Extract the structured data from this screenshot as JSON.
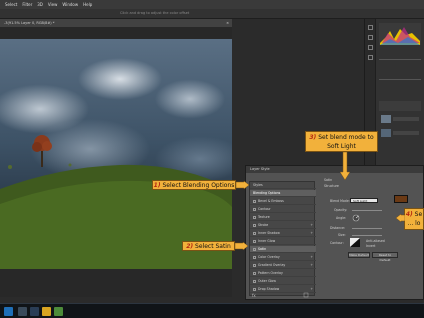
{
  "menubar": {
    "items": [
      "Select",
      "Filter",
      "3D",
      "View",
      "Window",
      "Help"
    ]
  },
  "options_hint": "Click and drag to adjust the color offset",
  "document": {
    "tab_title": "-3(91.5% Layer 0, RGB/8#) *",
    "close": "×"
  },
  "dialog": {
    "title": "Layer Style",
    "list_rows": [
      {
        "label": "Styles",
        "checkbox": false,
        "selected": false,
        "plus": false
      },
      {
        "label": "Blending Options",
        "checkbox": false,
        "selected": true,
        "plus": false
      },
      {
        "label": "Bevel & Emboss",
        "checkbox": true,
        "selected": false,
        "plus": false
      },
      {
        "label": "Contour",
        "checkbox": true,
        "selected": false,
        "plus": false
      },
      {
        "label": "Texture",
        "checkbox": true,
        "selected": false,
        "plus": false
      },
      {
        "label": "Stroke",
        "checkbox": true,
        "selected": false,
        "plus": true
      },
      {
        "label": "Inner Shadow",
        "checkbox": true,
        "selected": false,
        "plus": true
      },
      {
        "label": "Inner Glow",
        "checkbox": true,
        "selected": false,
        "plus": false
      },
      {
        "label": "Satin",
        "checkbox": true,
        "selected": true,
        "plus": false
      },
      {
        "label": "Color Overlay",
        "checkbox": true,
        "selected": false,
        "plus": true
      },
      {
        "label": "Gradient Overlay",
        "checkbox": true,
        "selected": false,
        "plus": true
      },
      {
        "label": "Pattern Overlay",
        "checkbox": true,
        "selected": false,
        "plus": false
      },
      {
        "label": "Outer Glow",
        "checkbox": true,
        "selected": false,
        "plus": false
      },
      {
        "label": "Drop Shadow",
        "checkbox": true,
        "selected": false,
        "plus": true
      }
    ],
    "section_title": "Satin",
    "section_subtitle": "Structure",
    "blend_mode_label": "Blend Mode:",
    "blend_mode_value": "Soft Light",
    "opacity_label": "Opacity:",
    "angle_label": "Angle:",
    "distance_label": "Distance:",
    "size_label": "Size:",
    "contour_label": "Contour:",
    "anti_aliased_label": "Anti-aliased",
    "invert_label": "Invert",
    "make_default": "Make Default",
    "reset_default": "Reset to Default",
    "satin_color": "#6b3a15"
  },
  "callouts": {
    "c1": {
      "num": "1)",
      "text": "Select Blending Options"
    },
    "c2": {
      "num": "2)",
      "text": "Select Satin"
    },
    "c3": {
      "num": "3)",
      "text": "Set blend mode to Soft Light"
    },
    "c4": {
      "num": "4)",
      "text": "Se ... lo"
    }
  },
  "colors": {
    "callout": "#f2b13b",
    "callout_num": "#b52a10"
  }
}
